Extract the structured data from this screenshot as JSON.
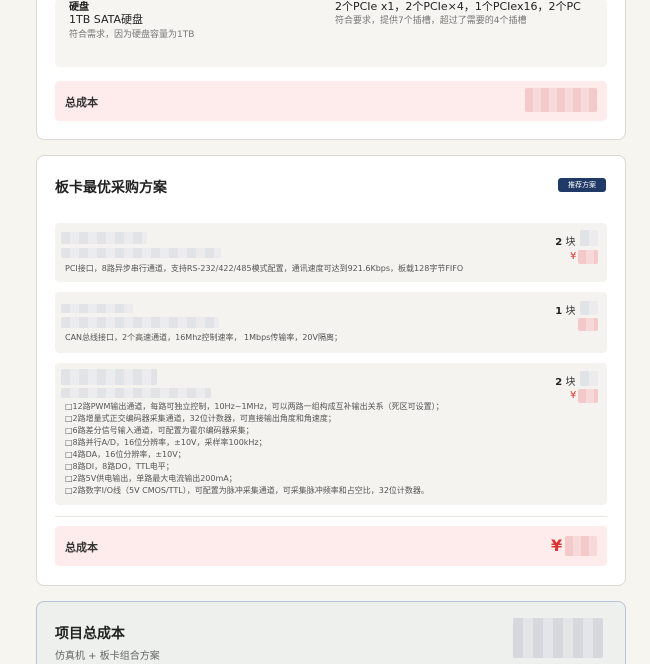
{
  "hardware_spec": {
    "storage_head": "硬盘",
    "storage_value": "1TB SATA硬盘",
    "storage_note": "符合需求，因为硬盘容量为1TB",
    "slots_value": "2个PCIe x1，2个PCIe×4，1个PCIex16，2个PC",
    "slots_note": "符合要求，提供7个插槽，超过了需要的4个插槽"
  },
  "simulator_total_label": "总成本",
  "board_section": {
    "title": "板卡最优采购方案",
    "badge": "推荐方案",
    "items": [
      {
        "qty_num": "2",
        "qty_unit": "块 ×",
        "currency": "¥",
        "desc_lines": [
          "PCI接口，8路异步串行通道，支持RS-232/422/485模式配置，通讯速度可达到921.6Kbps，板载128字节FIFO"
        ]
      },
      {
        "qty_num": "1",
        "qty_unit": "块 ×",
        "currency": "",
        "desc_lines": [
          "CAN总线接口，2个高速通道，16Mhz控制速率， 1Mbps传输率，20V隔离；"
        ]
      },
      {
        "qty_num": "2",
        "qty_unit": "块 ×",
        "currency": "¥",
        "desc_lines": [
          "□12路PWM输出通道，每路可独立控制，10Hz~1MHz，可以两路一组构成互补输出关系（死区可设置）；",
          "□2路增量式正交编码器采集通道，32位计数器，可直接输出角度和角速度；",
          "□6路差分信号输入通道，可配置为霍尔编码器采集；",
          "□8路并行A/D，16位分辨率，±10V，采样率100kHz；",
          "□4路DA，16位分辨率，±10V；",
          "□8路DI，8路DO，TTL电平；",
          "□2路5V供电输出，单路最大电流输出200mA；",
          "□2路数字I/O线（5V CMOS/TTL），可配置为脉冲采集通道，可采集脉冲频率和占空比，32位计数器。"
        ]
      }
    ],
    "total_label": "总成本",
    "total_currency": "¥"
  },
  "project_total": {
    "title": "项目总成本",
    "subtitle": "仿真机 + 板卡组合方案"
  },
  "colors": {
    "accent_navy": "#1f3a66",
    "price_red": "#d33333",
    "total_bg": "#fdeceb"
  }
}
